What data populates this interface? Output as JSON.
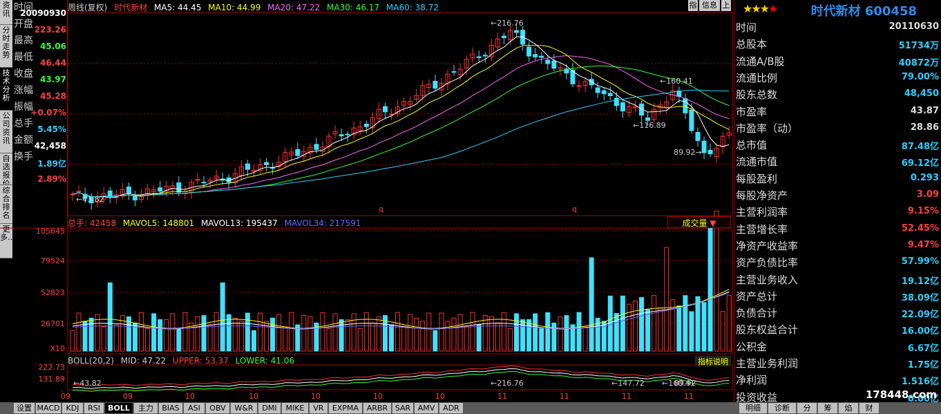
{
  "lefttabs": [
    "资讯",
    "分时走势",
    "技术分析",
    "公司资讯",
    "自选报价",
    "综合排名",
    "更多…"
  ],
  "info": {
    "time_label": "时间",
    "time_val": "20090930",
    "open_label": "开盘",
    "open_val": "223.26",
    "high_label": "最高",
    "high_val": "45.06",
    "low_label": "最低",
    "low_val": "46.44",
    "close_label": "收盘",
    "close_val": "43.97",
    "chg_label": "涨幅",
    "chg_val": "45.28",
    "amp_label": "振幅",
    "amp_val": "+0.07%",
    "vol_label": "总手",
    "vol_val": "5.45%",
    "amt_label": "金额",
    "amt_val": "42,458",
    "turn_label": "换手",
    "turn_val": "1.89亿",
    "extra_val": "2.89%"
  },
  "header": {
    "period": "周线(复权)",
    "name": "时代新材",
    "ma5": "MA5: 44.45",
    "ma10": "MA10: 44.99",
    "ma20": "MA20: 47.22",
    "ma30": "MA30: 46.17",
    "ma60": "MA60: 38.72"
  },
  "topbtns": [
    "指",
    "信息",
    "上"
  ],
  "price_labels": {
    "high": "216.76",
    "low0": "43.82",
    "p1": "160.41",
    "p2": "116.89",
    "p3": "89.92",
    "q": "q"
  },
  "vol": {
    "total": "总手: 42458",
    "mavol5": "MAVOL5: 148801",
    "mavol13": "MAVOL13: 195437",
    "mavol34": "MAVOL34: 217591",
    "select": "成交量",
    "ticks": [
      "105645",
      "79524",
      "52823",
      "26701",
      "X10"
    ]
  },
  "boll": {
    "label": "BOLL(20,2)",
    "mid": "MID: 47.22",
    "upper": "UPPER: 53.37",
    "lower": "LOWER: 41.06",
    "btn": "指标说明",
    "ticks": [
      "222.73",
      "131.89"
    ],
    "marks": [
      "43.82",
      "216.76",
      "160.41",
      "147.72",
      "89.92"
    ]
  },
  "xaxis": [
    "09",
    "09",
    "10",
    "10",
    "10",
    "10",
    "10",
    "11",
    "11",
    "11",
    "11",
    "11"
  ],
  "bottomtabs": [
    "设置",
    "MACD",
    "KDJ",
    "RSI",
    "BOLL",
    "主力",
    "BIAS",
    "ASI",
    "OBV",
    "W&R",
    "DMI",
    "MIKE",
    "VR",
    "EXPMA",
    "ARBR",
    "SAR",
    "AMV",
    "ADR"
  ],
  "righttabs": [
    "明细",
    "诊断",
    "分",
    "筹",
    "焰",
    "财"
  ],
  "watermark": "178448.com",
  "right": {
    "stars": "★★★",
    "star_red": "★",
    "title": "时代新材 600458",
    "rows": [
      {
        "l": "时间",
        "v": "20110630",
        "c": "#ddd"
      },
      {
        "l": "总股本",
        "v": "51734万",
        "c": "#2ad0ff"
      },
      {
        "l": "流通A/B股",
        "v": "40872万",
        "c": "#2ad0ff"
      },
      {
        "l": "流通比例",
        "v": "79.00%",
        "c": "#2ad0ff"
      },
      {
        "l": "股东总数",
        "v": "48,450",
        "c": "#2ad0ff"
      },
      {
        "l": "市盈率",
        "v": "43.87",
        "c": "#ddd"
      },
      {
        "l": "市盈率（动）",
        "v": "28.86",
        "c": "#ddd"
      },
      {
        "l": "总市值",
        "v": "87.48亿",
        "c": "#2ad0ff"
      },
      {
        "l": "流通市值",
        "v": "69.12亿",
        "c": "#2ad0ff"
      },
      {
        "l": "每股盈利",
        "v": "0.293",
        "c": "#2ad0ff"
      },
      {
        "l": "每股净资产",
        "v": "3.09",
        "c": "#ff4040"
      },
      {
        "l": "主营利润率",
        "v": "9.15%",
        "c": "#ff4040"
      },
      {
        "l": "主营增长率",
        "v": "52.45%",
        "c": "#ff4040"
      },
      {
        "l": "净资产收益率",
        "v": "9.47%",
        "c": "#ff4040"
      },
      {
        "l": "资产负债比率",
        "v": "57.99%",
        "c": "#2ad0ff"
      },
      {
        "l": "主营业务收入",
        "v": "19.12亿",
        "c": "#2ad0ff"
      },
      {
        "l": "资产总计",
        "v": "38.09亿",
        "c": "#2ad0ff"
      },
      {
        "l": "负债合计",
        "v": "22.09亿",
        "c": "#2ad0ff"
      },
      {
        "l": "股东权益合计",
        "v": "16.00亿",
        "c": "#2ad0ff"
      },
      {
        "l": "公积金",
        "v": "6.67亿",
        "c": "#2ad0ff"
      },
      {
        "l": "主营业务利润",
        "v": "1.75亿",
        "c": "#2ad0ff"
      },
      {
        "l": "净利润",
        "v": "1.516亿",
        "c": "#2ad0ff"
      },
      {
        "l": "投资收益",
        "v": "0.00亿",
        "c": "#2ad0ff"
      }
    ]
  }
}
